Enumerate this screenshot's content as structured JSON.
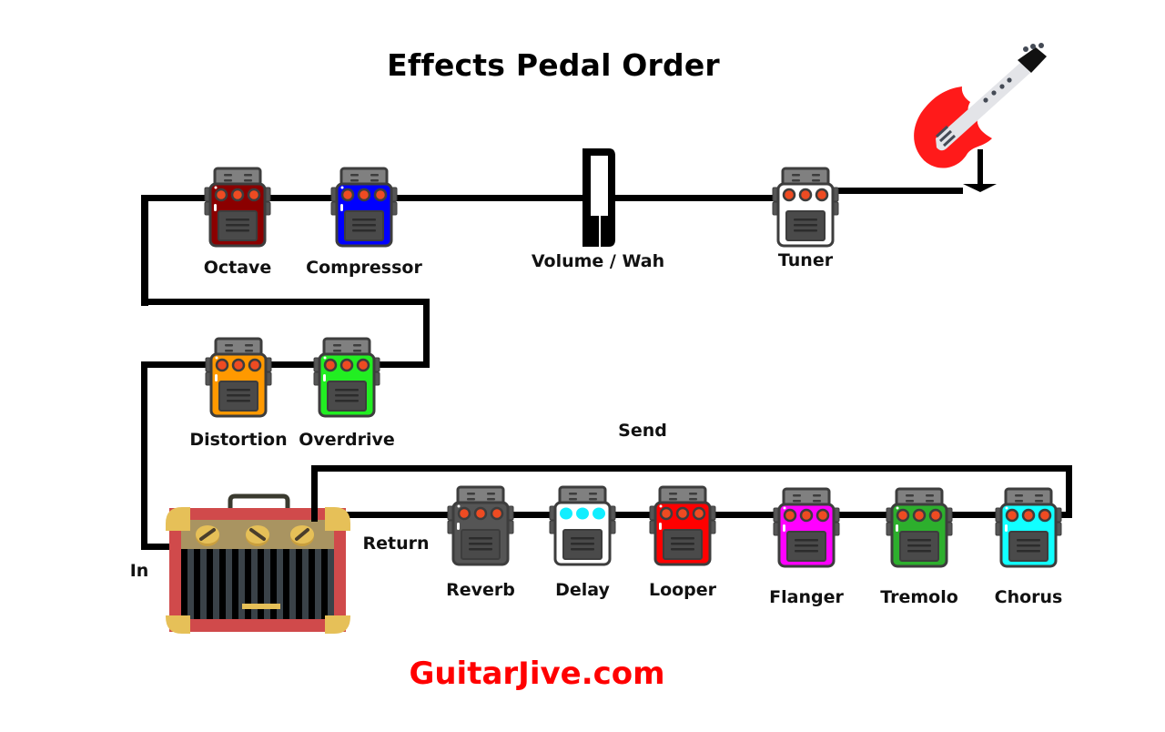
{
  "title": "Effects Pedal Order",
  "brand": {
    "text": "GuitarJive.com",
    "color": "#ff0000"
  },
  "guitar": {
    "icon": "electric-guitar-icon",
    "body_color": "#ff1a1a",
    "neck_color": "#e3e4e8",
    "head_color": "#111111"
  },
  "amp": {
    "icon": "guitar-amp-icon",
    "frame_color": "#d04a4b",
    "corner_color": "#e6c058",
    "panel_color": "#a99461",
    "grille_color": "#3a4248",
    "input_label": "In",
    "return_label": "Return",
    "send_label": "Send"
  },
  "signal_chain": {
    "row1": [
      {
        "name": "Tuner",
        "type": "pedal",
        "body": "#ffffff",
        "knobs": "#ee4b22"
      },
      {
        "name": "Volume / Wah",
        "type": "expression"
      },
      {
        "name": "Compressor",
        "type": "pedal",
        "body": "#0000ff",
        "knobs": "#ee4b22"
      },
      {
        "name": "Octave",
        "type": "pedal",
        "body": "#8b0000",
        "knobs": "#ee4b22"
      }
    ],
    "row2": [
      {
        "name": "Overdrive",
        "type": "pedal",
        "body": "#22ee22",
        "knobs": "#ee4b22"
      },
      {
        "name": "Distortion",
        "type": "pedal",
        "body": "#ff9900",
        "knobs": "#ee4b22"
      }
    ],
    "effects_loop": [
      {
        "name": "Chorus",
        "type": "pedal",
        "body": "#11ffff",
        "knobs": "#ee4b22"
      },
      {
        "name": "Tremolo",
        "type": "pedal",
        "body": "#2daf2d",
        "knobs": "#ee4b22"
      },
      {
        "name": "Flanger",
        "type": "pedal",
        "body": "#ff00ff",
        "knobs": "#ee4b22"
      },
      {
        "name": "Looper",
        "type": "pedal",
        "body": "#ff0000",
        "knobs": "#ee4b22"
      },
      {
        "name": "Delay",
        "type": "pedal",
        "body": "#ffffff",
        "knobs": "#11eeff"
      },
      {
        "name": "Reverb",
        "type": "pedal",
        "body": "#555555",
        "knobs": "#ee4b22"
      }
    ]
  }
}
